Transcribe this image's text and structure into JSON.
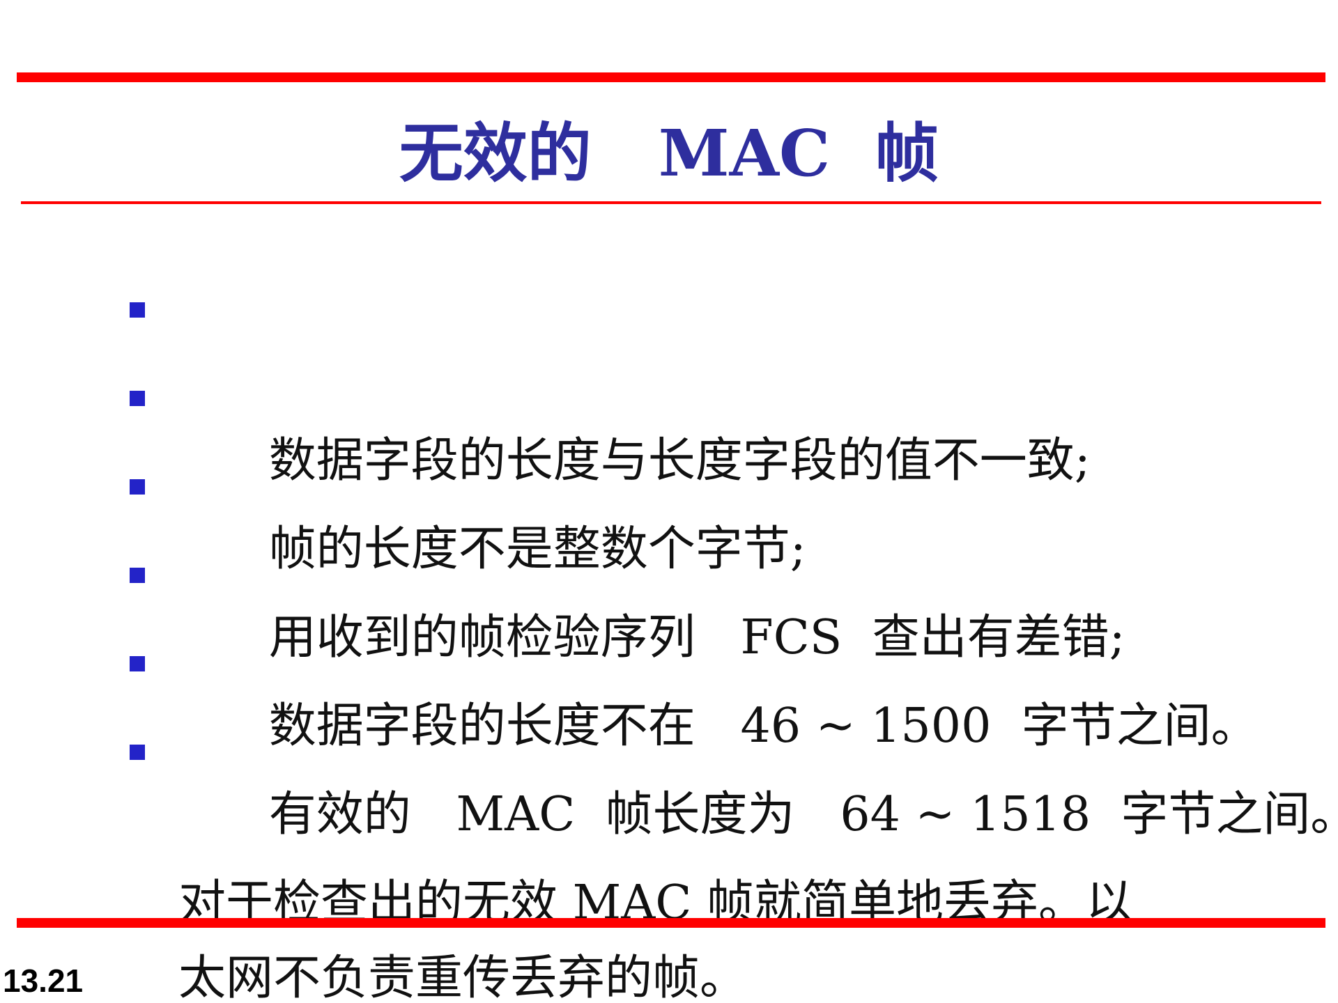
{
  "slide": {
    "title": "无效的   MAC  帧",
    "accent_color": "#ff0000",
    "title_color": "#2e2e9e",
    "bullet_color": "#2323c8",
    "bullet_marker": "square-bullet-icon",
    "bullets": [
      "数据字段的长度与长度字段的值不一致;",
      "帧的长度不是整数个字节;",
      "用收到的帧检验序列   FCS  查出有差错;",
      "数据字段的长度不在   46 ~ 1500  字节之间。",
      "有效的   MAC  帧长度为   64 ~ 1518  字节之间。",
      "对于检查出的无效   MAC  帧就简单地丢弃。以\n太网不负责重传丢弃的帧。"
    ],
    "page_number": "13.21"
  }
}
